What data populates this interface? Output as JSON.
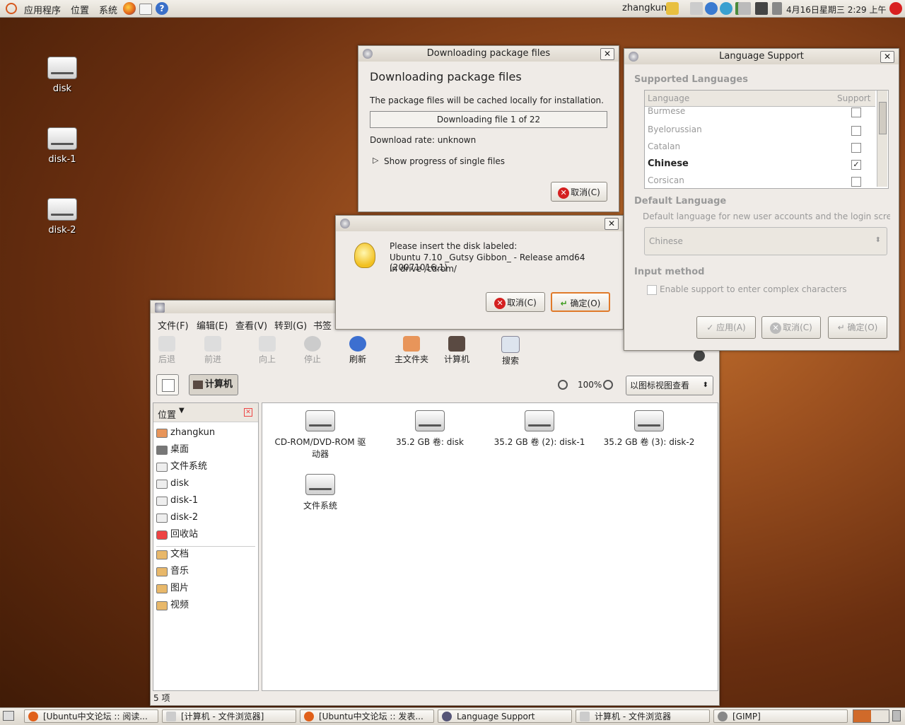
{
  "top_panel": {
    "menus": [
      "应用程序",
      "位置",
      "系统"
    ],
    "user": "zhangkun",
    "datetime": "4月16日星期三  2:29 上午"
  },
  "desktop": {
    "icons": [
      "disk",
      "disk-1",
      "disk-2"
    ]
  },
  "download_dialog": {
    "title": "Downloading package files",
    "heading": "Downloading package files",
    "description": "The package files will be cached locally for installation.",
    "progress_text": "Downloading file 1 of 22",
    "progress": 0.0,
    "rate": "Download rate: unknown",
    "expander": "Show progress of single files",
    "cancel": "取消(C)"
  },
  "insert_dialog": {
    "line1": "Please insert the disk labeled:",
    "line2": "Ubuntu 7.10 _Gutsy Gibbon_ - Release amd64 (20071016.1)",
    "line3": "in drive /cdrom/",
    "cancel": "取消(C)",
    "ok": "确定(O)"
  },
  "language_support": {
    "title": "Language Support",
    "supported_heading": "Supported Languages",
    "col_language": "Language",
    "col_support": "Support",
    "rows": [
      {
        "name": "Burmese",
        "checked": false
      },
      {
        "name": "Byelorussian",
        "checked": false
      },
      {
        "name": "Catalan",
        "checked": false
      },
      {
        "name": "Chinese",
        "checked": true
      },
      {
        "name": "Corsican",
        "checked": false
      }
    ],
    "default_heading": "Default Language",
    "default_desc": "Default language for new user accounts and the login screen:",
    "default_value": "Chinese",
    "input_heading": "Input method",
    "input_option": "Enable support to enter complex characters",
    "apply": "应用(A)",
    "cancel": "取消(C)",
    "ok": "确定(O)"
  },
  "file_browser": {
    "menu": [
      "文件(F)",
      "编辑(E)",
      "查看(V)",
      "转到(G)",
      "书签"
    ],
    "toolbar": {
      "back": "后退",
      "forward": "前进",
      "up": "向上",
      "stop": "停止",
      "refresh": "刷新",
      "home": "主文件夹",
      "computer": "计算机",
      "search": "搜索"
    },
    "location_button": "计算机",
    "zoom": "100%",
    "view_mode": "以图标视图查看",
    "sidebar_title": "位置",
    "sidebar_items": [
      "zhangkun",
      "桌面",
      "文件系统",
      "disk",
      "disk-1",
      "disk-2",
      "回收站"
    ],
    "bookmarks": [
      "文档",
      "音乐",
      "图片",
      "视频"
    ],
    "files": [
      "CD-ROM/DVD-ROM 驱动器",
      "35.2 GB 卷: disk",
      "35.2 GB 卷 (2): disk-1",
      "35.2 GB 卷 (3): disk-2",
      "文件系统"
    ],
    "status": "5 项"
  },
  "taskbar": [
    "[Ubuntu中文论坛 :: 阅读...",
    "[计算机 - 文件浏览器]",
    "[Ubuntu中文论坛 :: 发表...",
    "Language Support",
    "计算机 - 文件浏览器",
    "[GIMP]"
  ]
}
